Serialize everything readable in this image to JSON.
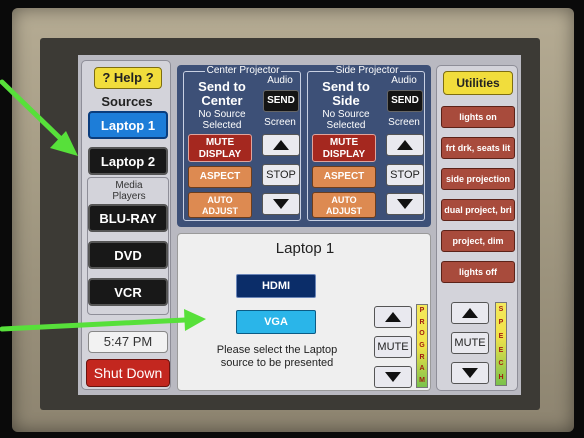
{
  "left_panel": {
    "help_label": "? Help ?",
    "sources_label": "Sources",
    "sources": [
      "Laptop 1",
      "Laptop 2"
    ],
    "media_label_line1": "Media",
    "media_label_line2": "Players",
    "media_players": [
      "BLU-RAY",
      "DVD",
      "VCR"
    ],
    "time": "5:47 PM",
    "shutdown_label": "Shut Down"
  },
  "projectors": {
    "center": {
      "title": "Center Projector",
      "send_line1": "Send to",
      "send_line2": "Center",
      "status_line1": "No Source",
      "status_line2": "Selected",
      "audio_label": "Audio",
      "send_button": "SEND",
      "screen_label": "Screen",
      "mute_line1": "MUTE",
      "mute_line2": "DISPLAY",
      "aspect_label": "ASPECT",
      "stop_label": "STOP",
      "auto_line1": "AUTO",
      "auto_line2": "ADJUST"
    },
    "side": {
      "title": "Side Projector",
      "send_line1": "Send to",
      "send_line2": "Side",
      "status_line1": "No Source",
      "status_line2": "Selected",
      "audio_label": "Audio",
      "send_button": "SEND",
      "screen_label": "Screen",
      "mute_line1": "MUTE",
      "mute_line2": "DISPLAY",
      "aspect_label": "ASPECT",
      "stop_label": "STOP",
      "auto_line1": "AUTO",
      "auto_line2": "ADJUST"
    }
  },
  "utilities": {
    "header": "Utilities",
    "items": [
      "lights on",
      "frt drk, seats lit",
      "side projection",
      "dual project, bri",
      "project, dim",
      "lights off"
    ]
  },
  "detail": {
    "title": "Laptop 1",
    "hdmi_label": "HDMI",
    "vga_label": "VGA",
    "instruction_line1": "Please select the Laptop",
    "instruction_line2": "source to be presented",
    "mute_label": "MUTE",
    "program_letters": [
      "P",
      "R",
      "O",
      "G",
      "R",
      "A",
      "M"
    ]
  },
  "speech": {
    "mute_label": "MUTE",
    "speech_letters": [
      "S",
      "P",
      "E",
      "E",
      "C",
      "H"
    ]
  },
  "colors": {
    "selected_source": "#1d7dd8",
    "projector_panel": "#3d5077",
    "help_yellow": "#f1dd3c",
    "utility_red": "#a84b3c",
    "shutdown_red": "#c3271f",
    "annotation_arrow": "#57e03a"
  }
}
